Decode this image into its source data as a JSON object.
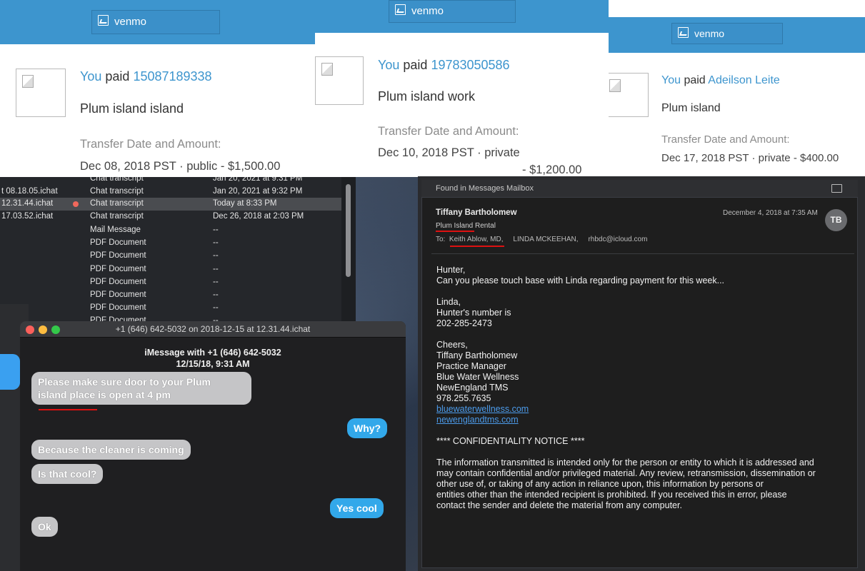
{
  "venmo": {
    "brand": "venmo",
    "accent": "#3d95ce",
    "transfer_label": "Transfer Date and Amount:",
    "cards": [
      {
        "you": "You",
        "paid": "paid",
        "recipient": "15087189338",
        "note": "Plum island island",
        "date": "Dec 08, 2018 PST · public",
        "amount": "- $1,500.00"
      },
      {
        "you": "You",
        "paid": "paid",
        "recipient": "19783050586",
        "note": "Plum island work",
        "date": "Dec 10, 2018 PST · private",
        "amount": "- $1,200.00"
      },
      {
        "you": "You",
        "paid": "paid",
        "recipient": "Adeilson Leite",
        "note": "Plum island",
        "date": "Dec 17, 2018 PST · private",
        "amount": "- $400.00"
      }
    ]
  },
  "finder": {
    "rows": [
      {
        "name": "",
        "kind": "Chat transcript",
        "date": "Jan 20, 2021 at 9:31 PM"
      },
      {
        "name": "t 08.18.05.ichat",
        "kind": "Chat transcript",
        "date": "Jan 20, 2021 at 9:32 PM"
      },
      {
        "name": "12.31.44.ichat",
        "kind": "Chat transcript",
        "date": "Today at 8:33 PM"
      },
      {
        "name": "17.03.52.ichat",
        "kind": "Chat transcript",
        "date": "Dec 26, 2018 at 2:03 PM"
      },
      {
        "name": "",
        "kind": "Mail Message",
        "date": "--"
      },
      {
        "name": "",
        "kind": "PDF Document",
        "date": "--"
      },
      {
        "name": "",
        "kind": "PDF Document",
        "date": "--"
      },
      {
        "name": "",
        "kind": "PDF Document",
        "date": "--"
      },
      {
        "name": "",
        "kind": "PDF Document",
        "date": "--"
      },
      {
        "name": "",
        "kind": "PDF Document",
        "date": "--"
      },
      {
        "name": "",
        "kind": "PDF Document",
        "date": "--"
      },
      {
        "name": "",
        "kind": "PDF Document",
        "date": "--"
      }
    ]
  },
  "messages": {
    "window_title": "+1 (646) 642-5032 on 2018-12-15 at 12.31.44.ichat",
    "header_line1": "iMessage with +1 (646) 642-5032",
    "header_line2": "12/15/18, 9:31 AM",
    "bubbles": [
      {
        "from": "them",
        "text_line1": "Please make sure door to your Plum",
        "text_line2": "island place is open at 4 pm"
      },
      {
        "from": "me",
        "text": "Why?"
      },
      {
        "from": "them",
        "text": "Because the cleaner is coming"
      },
      {
        "from": "them",
        "text": "Is that cool?"
      },
      {
        "from": "me",
        "text": "Yes cool"
      },
      {
        "from": "them",
        "text": "Ok"
      }
    ]
  },
  "mail": {
    "mailbox": "Found in Messages Mailbox",
    "sender": "Tiffany Bartholomew",
    "subject": "Plum Island Rental",
    "to_label": "To:",
    "recipients": [
      "Keith Ablow, MD,",
      "LINDA MCKEEHAN,",
      "rhbdc@icloud.com"
    ],
    "date": "December 4, 2018 at 7:35 AM",
    "avatar_initials": "TB",
    "body": [
      "Hunter,",
      "Can you please touch base with Linda regarding payment for this week...",
      "Linda,",
      "Hunter's number is",
      "202-285-2473",
      "Cheers,",
      "Tiffany Bartholomew",
      "Practice Manager",
      "Blue Water Wellness",
      "NewEngland TMS",
      "978.255.7635",
      "bluewaterwellness.com",
      "newenglandtms.com",
      "**** CONFIDENTIALITY NOTICE ****",
      "The information transmitted is intended only for the person or entity to which it is addressed and",
      "may contain confidential and/or privileged material. Any review, retransmission, dissemination or",
      "other use of, or taking of any action in reliance upon, this information by persons or",
      "entities other than the intended recipient is prohibited. If you received this in error, please",
      "contact the sender and delete the material from any computer."
    ]
  }
}
